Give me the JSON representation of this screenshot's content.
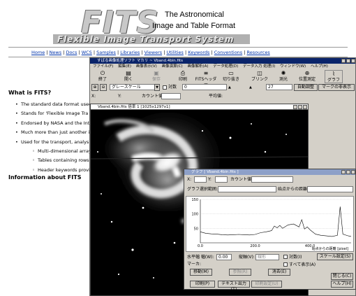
{
  "logo": {
    "fits": "FITS",
    "line1": "The Astronomical",
    "line2": "Image and Table Format",
    "subtitle": "Flexible Image Transport System"
  },
  "nav_links": [
    "Home",
    "News",
    "Docs",
    "WCS",
    "Samples",
    "Libraries",
    "Viewers",
    "Utilities",
    "Keywords",
    "Conventions",
    "Resources"
  ],
  "page": {
    "heading_what": "What is FITS?",
    "bullets": [
      "The standard data format used",
      "Stands for 'Flexible Image Tra",
      "Endorsed by NASA and the Int",
      "Much more than just another in",
      "Used for the transport, analysis"
    ],
    "sub_bullets": [
      "Multi-dimensional arrays",
      "Tables containing rows a",
      "Header keywords provid"
    ],
    "heading_info": "Information about FITS"
  },
  "app": {
    "title": "すばる画像処理ソフト マカリ ~ Vband.4bin.fits",
    "menu": [
      "ファイル(F)",
      "編集(E)",
      "画像表示(V)",
      "画像演算(C)",
      "画像解析(A)",
      "データ処理(D)",
      "データ入力 処理(I)",
      "ウィンドウ(W)",
      "ヘルプ(H)"
    ],
    "toolbar": [
      "終了",
      "開く",
      "保存",
      "印刷",
      "FITSヘッダー",
      "切り抜き",
      "ブリンク",
      "測光",
      "位置測定",
      "グラフ"
    ],
    "colormap": "グレースケール",
    "log_label": "対数",
    "min_value": "0",
    "max_value": "27",
    "auto_button": "自動調整",
    "mark_button": "マークの非表示",
    "x_label": "X:",
    "y_label": "Y:",
    "count_label": "カウント値:",
    "mean_label": "平均値:"
  },
  "image_window": {
    "title": "Vband.4bin.fits 倍率 1 [1025x1297x1]"
  },
  "graph_window": {
    "title": "グラフ [ Vband.4bin.fits ]",
    "x_label": "X:",
    "y_label": "Y:",
    "count_label": "カウント値:",
    "slice_label": "グラフ選択範囲:",
    "start_distance_label": "始点からの距離:",
    "y_ticks": [
      "150",
      "100",
      "50"
    ],
    "x_ticks": [
      "0.0",
      "200.0",
      "400.0"
    ],
    "x_axis_title": "始点からの距離 [pixel]",
    "width_label": "水平幅 幅(W):",
    "width_value": "0.00",
    "vertical_label": "縦軸(V):",
    "vertical_value": "線形",
    "log_label": "対数(I)",
    "scale_button": "スケール設定(S)",
    "marker_label": "マーカ:",
    "all_label": "すべて表示(A)",
    "buttons_row1": [
      "移動(M)",
      "参照(R)",
      "消去(E)"
    ],
    "close_button": "閉じる(C)",
    "buttons_row2": [
      "印刷(P)",
      "テキスト出力(T)",
      "印刷設定(U)"
    ],
    "help_button": "ヘルプ(H)"
  },
  "chart_data": {
    "type": "line",
    "title": "",
    "xlabel": "始点からの距離 [pixel]",
    "ylabel": "",
    "xlim": [
      0,
      550
    ],
    "ylim": [
      0,
      150
    ],
    "x": [
      0,
      20,
      40,
      60,
      80,
      100,
      120,
      140,
      160,
      180,
      200,
      220,
      240,
      260,
      270,
      280,
      290,
      300,
      320,
      340,
      360,
      370,
      380,
      390,
      400,
      420,
      440,
      460,
      480,
      500,
      510,
      520,
      540,
      550
    ],
    "series": [
      {
        "values": [
          38,
          33,
          31,
          30,
          28,
          27,
          28,
          29,
          28,
          27,
          29,
          35,
          38,
          42,
          58,
          52,
          60,
          50,
          62,
          65,
          55,
          80,
          48,
          55,
          45,
          30,
          26,
          24,
          22,
          26,
          125,
          30,
          24,
          22
        ]
      }
    ]
  }
}
